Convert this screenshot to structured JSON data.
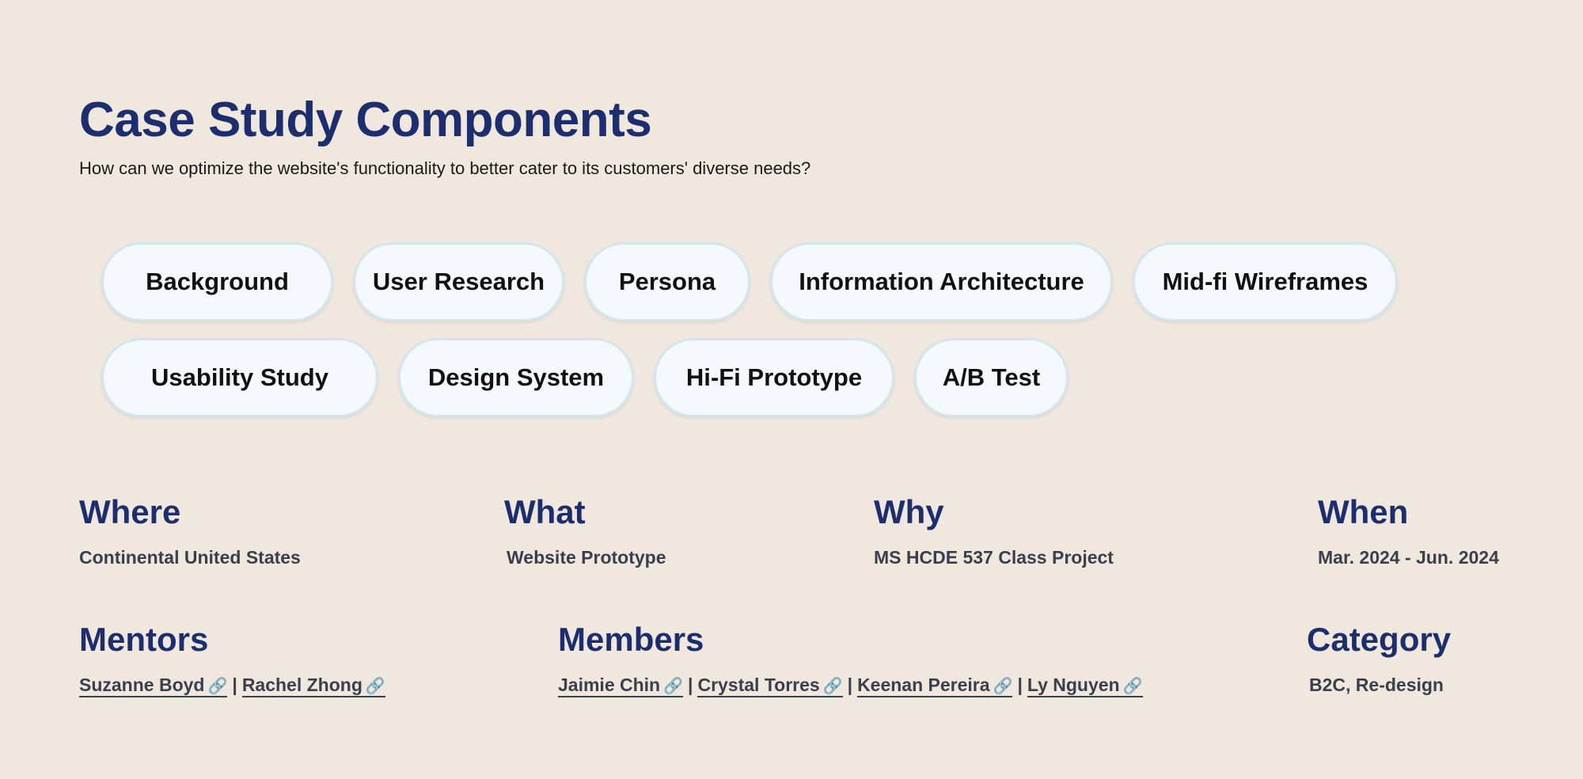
{
  "header": {
    "title": "Case Study Components",
    "subtitle": "How can we optimize the website's functionality to better cater to its customers' diverse needs?"
  },
  "components": [
    "Background",
    "User Research",
    "Persona",
    "Information Architecture",
    "Mid-fi Wireframes",
    "Usability Study",
    "Design System",
    "Hi-Fi Prototype",
    "A/B Test"
  ],
  "info": {
    "where": {
      "heading": "Where",
      "value": "Continental United States"
    },
    "what": {
      "heading": "What",
      "value": "Website Prototype"
    },
    "why": {
      "heading": "Why",
      "value": "MS HCDE 537 Class Project"
    },
    "when": {
      "heading": "When",
      "value": "Mar. 2024 - Jun. 2024"
    },
    "mentors": {
      "heading": "Mentors",
      "people": [
        "Suzanne Boyd",
        "Rachel Zhong"
      ]
    },
    "members": {
      "heading": "Members",
      "people": [
        "Jaimie Chin",
        "Crystal Torres",
        "Keenan Pereira",
        "Ly Nguyen"
      ]
    },
    "category": {
      "heading": "Category",
      "value": "B2C, Re-design"
    }
  },
  "separator": "|",
  "link_icon": "🔗",
  "icons": {
    "link": "link-icon"
  },
  "colors": {
    "heading": "#1c2e6e",
    "background": "#f0e7df",
    "pill_bg": "#f5f9fd",
    "pill_border": "#d3e6e9"
  }
}
